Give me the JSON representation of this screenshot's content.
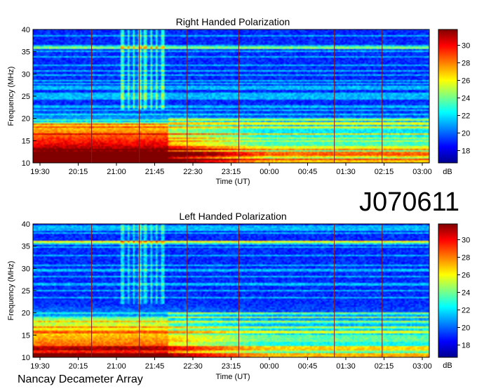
{
  "observation_id": "J070611",
  "footer": "Nancay Decameter Array",
  "chart_data": [
    {
      "type": "heatmap",
      "title": "Right Handed Polarization",
      "xlabel": "Time (UT)",
      "ylabel": "Frequency (MHz)",
      "colorbar_label": "dB",
      "x_ticks": [
        "19:30",
        "20:15",
        "21:00",
        "21:45",
        "22:30",
        "23:15",
        "00:00",
        "00:45",
        "01:30",
        "02:15",
        "03:00"
      ],
      "y_ticks": [
        10,
        15,
        20,
        25,
        30,
        35,
        40
      ],
      "ylim": [
        10,
        40
      ],
      "colorbar_ticks": [
        18,
        20,
        22,
        24,
        26,
        28,
        30
      ],
      "colorbar_range": [
        16.6,
        31.8
      ],
      "colormap": [
        "#00008f",
        "#0000ff",
        "#00ffff",
        "#ffff00",
        "#ff0000",
        "#800000"
      ],
      "approx_background_db": 19,
      "approx_peak_db": 31
    },
    {
      "type": "heatmap",
      "title": "Left Handed Polarization",
      "xlabel": "Time (UT)",
      "ylabel": "Frequency (MHz)",
      "colorbar_label": "dB",
      "x_ticks": [
        "19:30",
        "20:15",
        "21:00",
        "21:45",
        "22:30",
        "23:15",
        "00:00",
        "00:45",
        "01:30",
        "02:15",
        "03:00"
      ],
      "y_ticks": [
        10,
        15,
        20,
        25,
        30,
        35,
        40
      ],
      "ylim": [
        10,
        40
      ],
      "colorbar_ticks": [
        18,
        20,
        22,
        24,
        26,
        28,
        30
      ],
      "colorbar_range": [
        16.6,
        31.8
      ],
      "colormap": [
        "#00008f",
        "#0000ff",
        "#00ffff",
        "#ffff00",
        "#ff0000",
        "#800000"
      ],
      "approx_background_db": 19,
      "approx_peak_db": 31
    }
  ]
}
